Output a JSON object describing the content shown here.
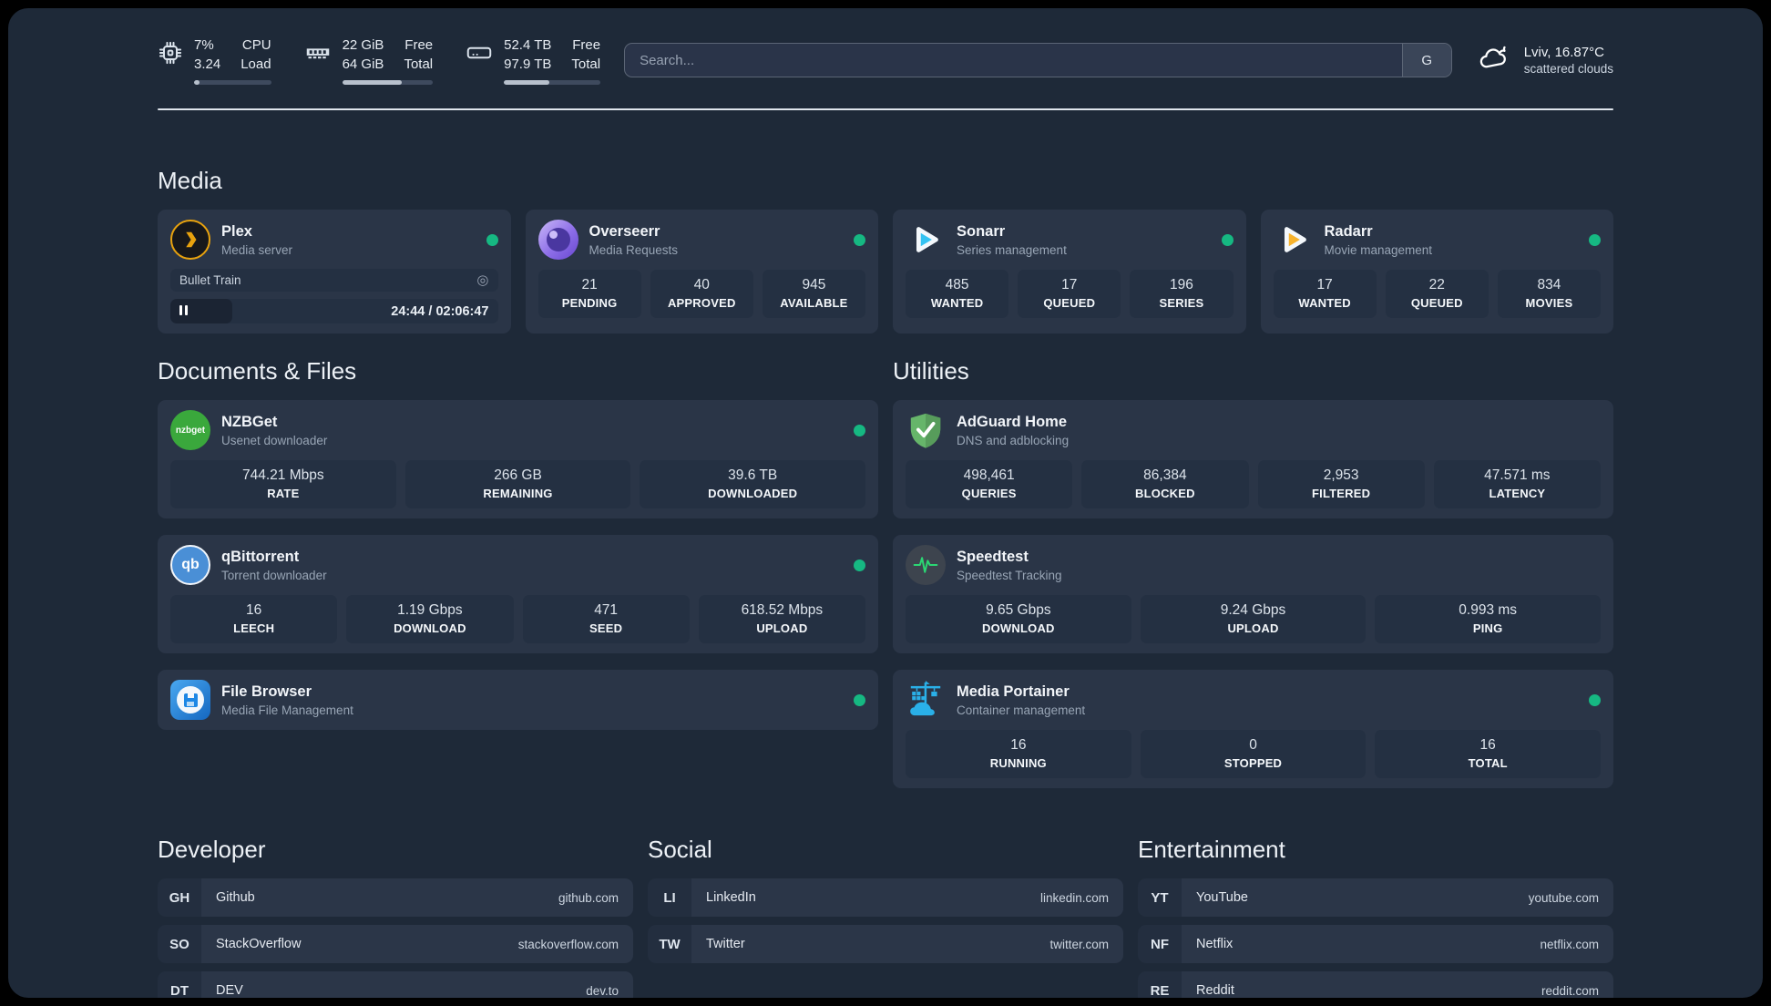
{
  "theme": {
    "background": "#1e2938",
    "card": "#2a3547",
    "tile": "#243042",
    "status_green": "#16b882",
    "divider": "#dfe5ec"
  },
  "header": {
    "metrics": [
      {
        "icon": "cpu-icon",
        "value1": "7%",
        "value2": "3.24",
        "label1": "CPU",
        "label2": "Load",
        "progress": 7
      },
      {
        "icon": "ram-icon",
        "value1": "22 GiB",
        "value2": "64 GiB",
        "label1": "Free",
        "label2": "Total",
        "progress": 66
      },
      {
        "icon": "disk-icon",
        "value1": "52.4 TB",
        "value2": "97.9 TB",
        "label1": "Free",
        "label2": "Total",
        "progress": 47
      }
    ],
    "search_placeholder": "Search...",
    "search_button": "G",
    "weather": {
      "title": "Lviv, 16.87°C",
      "subtitle": "scattered clouds"
    }
  },
  "media": {
    "title": "Media",
    "plex": {
      "name": "Plex",
      "subtitle": "Media server",
      "now_playing": "Bullet Train",
      "time": "24:44 / 02:06:47",
      "progress_pct": 19
    },
    "overseerr": {
      "name": "Overseerr",
      "subtitle": "Media Requests",
      "stats": [
        {
          "value": "21",
          "label": "PENDING"
        },
        {
          "value": "40",
          "label": "APPROVED"
        },
        {
          "value": "945",
          "label": "AVAILABLE"
        }
      ]
    },
    "sonarr": {
      "name": "Sonarr",
      "subtitle": "Series management",
      "stats": [
        {
          "value": "485",
          "label": "WANTED"
        },
        {
          "value": "17",
          "label": "QUEUED"
        },
        {
          "value": "196",
          "label": "SERIES"
        }
      ]
    },
    "radarr": {
      "name": "Radarr",
      "subtitle": "Movie management",
      "stats": [
        {
          "value": "17",
          "label": "WANTED"
        },
        {
          "value": "22",
          "label": "QUEUED"
        },
        {
          "value": "834",
          "label": "MOVIES"
        }
      ]
    }
  },
  "documents": {
    "title": "Documents & Files",
    "nzbget": {
      "name": "NZBGet",
      "subtitle": "Usenet downloader",
      "stats": [
        {
          "value": "744.21 Mbps",
          "label": "RATE"
        },
        {
          "value": "266 GB",
          "label": "REMAINING"
        },
        {
          "value": "39.6 TB",
          "label": "DOWNLOADED"
        }
      ]
    },
    "qbittorrent": {
      "name": "qBittorrent",
      "subtitle": "Torrent downloader",
      "stats": [
        {
          "value": "16",
          "label": "LEECH"
        },
        {
          "value": "1.19 Gbps",
          "label": "DOWNLOAD"
        },
        {
          "value": "471",
          "label": "SEED"
        },
        {
          "value": "618.52 Mbps",
          "label": "UPLOAD"
        }
      ]
    },
    "filebrowser": {
      "name": "File Browser",
      "subtitle": "Media File Management"
    }
  },
  "utilities": {
    "title": "Utilities",
    "adguard": {
      "name": "AdGuard Home",
      "subtitle": "DNS and adblocking",
      "stats": [
        {
          "value": "498,461",
          "label": "QUERIES"
        },
        {
          "value": "86,384",
          "label": "BLOCKED"
        },
        {
          "value": "2,953",
          "label": "FILTERED"
        },
        {
          "value": "47.571 ms",
          "label": "LATENCY"
        }
      ]
    },
    "speedtest": {
      "name": "Speedtest",
      "subtitle": "Speedtest Tracking",
      "stats": [
        {
          "value": "9.65 Gbps",
          "label": "DOWNLOAD"
        },
        {
          "value": "9.24 Gbps",
          "label": "UPLOAD"
        },
        {
          "value": "0.993 ms",
          "label": "PING"
        }
      ]
    },
    "portainer": {
      "name": "Media Portainer",
      "subtitle": "Container management",
      "stats": [
        {
          "value": "16",
          "label": "RUNNING"
        },
        {
          "value": "0",
          "label": "STOPPED"
        },
        {
          "value": "16",
          "label": "TOTAL"
        }
      ]
    }
  },
  "links": {
    "developer": {
      "title": "Developer",
      "items": [
        {
          "abbr": "GH",
          "name": "Github",
          "url": "github.com"
        },
        {
          "abbr": "SO",
          "name": "StackOverflow",
          "url": "stackoverflow.com"
        },
        {
          "abbr": "DT",
          "name": "DEV",
          "url": "dev.to"
        }
      ]
    },
    "social": {
      "title": "Social",
      "items": [
        {
          "abbr": "LI",
          "name": "LinkedIn",
          "url": "linkedin.com"
        },
        {
          "abbr": "TW",
          "name": "Twitter",
          "url": "twitter.com"
        }
      ]
    },
    "entertainment": {
      "title": "Entertainment",
      "items": [
        {
          "abbr": "YT",
          "name": "YouTube",
          "url": "youtube.com"
        },
        {
          "abbr": "NF",
          "name": "Netflix",
          "url": "netflix.com"
        },
        {
          "abbr": "RE",
          "name": "Reddit",
          "url": "reddit.com"
        }
      ]
    }
  }
}
